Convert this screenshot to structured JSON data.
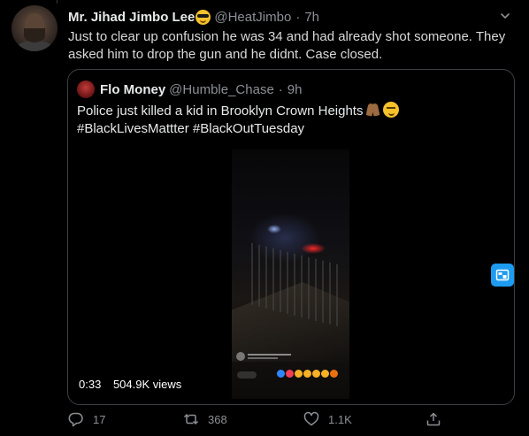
{
  "tweet": {
    "author_name": "Mr. Jihad Jimbo Lee",
    "author_handle": "@HeatJimbo",
    "separator": "·",
    "time": "7h",
    "text": "Just to clear up confusion he was 34 and had already shot someone. They asked him to drop the gun and he didnt. Case closed."
  },
  "quote": {
    "author_name": "Flo Money",
    "author_handle": "@Humble_Chase",
    "separator": "·",
    "time": "9h",
    "text_line1": "Police just killed a kid in Brooklyn Crown Heights",
    "text_line2": "#BlackLivesMattter #BlackOutTuesday",
    "video": {
      "duration": "0:33",
      "views": "504.9K views"
    }
  },
  "actions": {
    "reply_count": "17",
    "retweet_count": "368",
    "like_count": "1.1K"
  },
  "colors": {
    "background": "#000000",
    "accent": "#1d9bf0",
    "muted_text": "#8b8f94",
    "border": "#3b3f44"
  },
  "icons": [
    "caret-down-icon",
    "cool-emoji-icon",
    "pray-emoji-icon",
    "smirk-emoji-icon",
    "picture-in-picture-icon",
    "reply-icon",
    "retweet-icon",
    "like-icon",
    "share-icon"
  ]
}
